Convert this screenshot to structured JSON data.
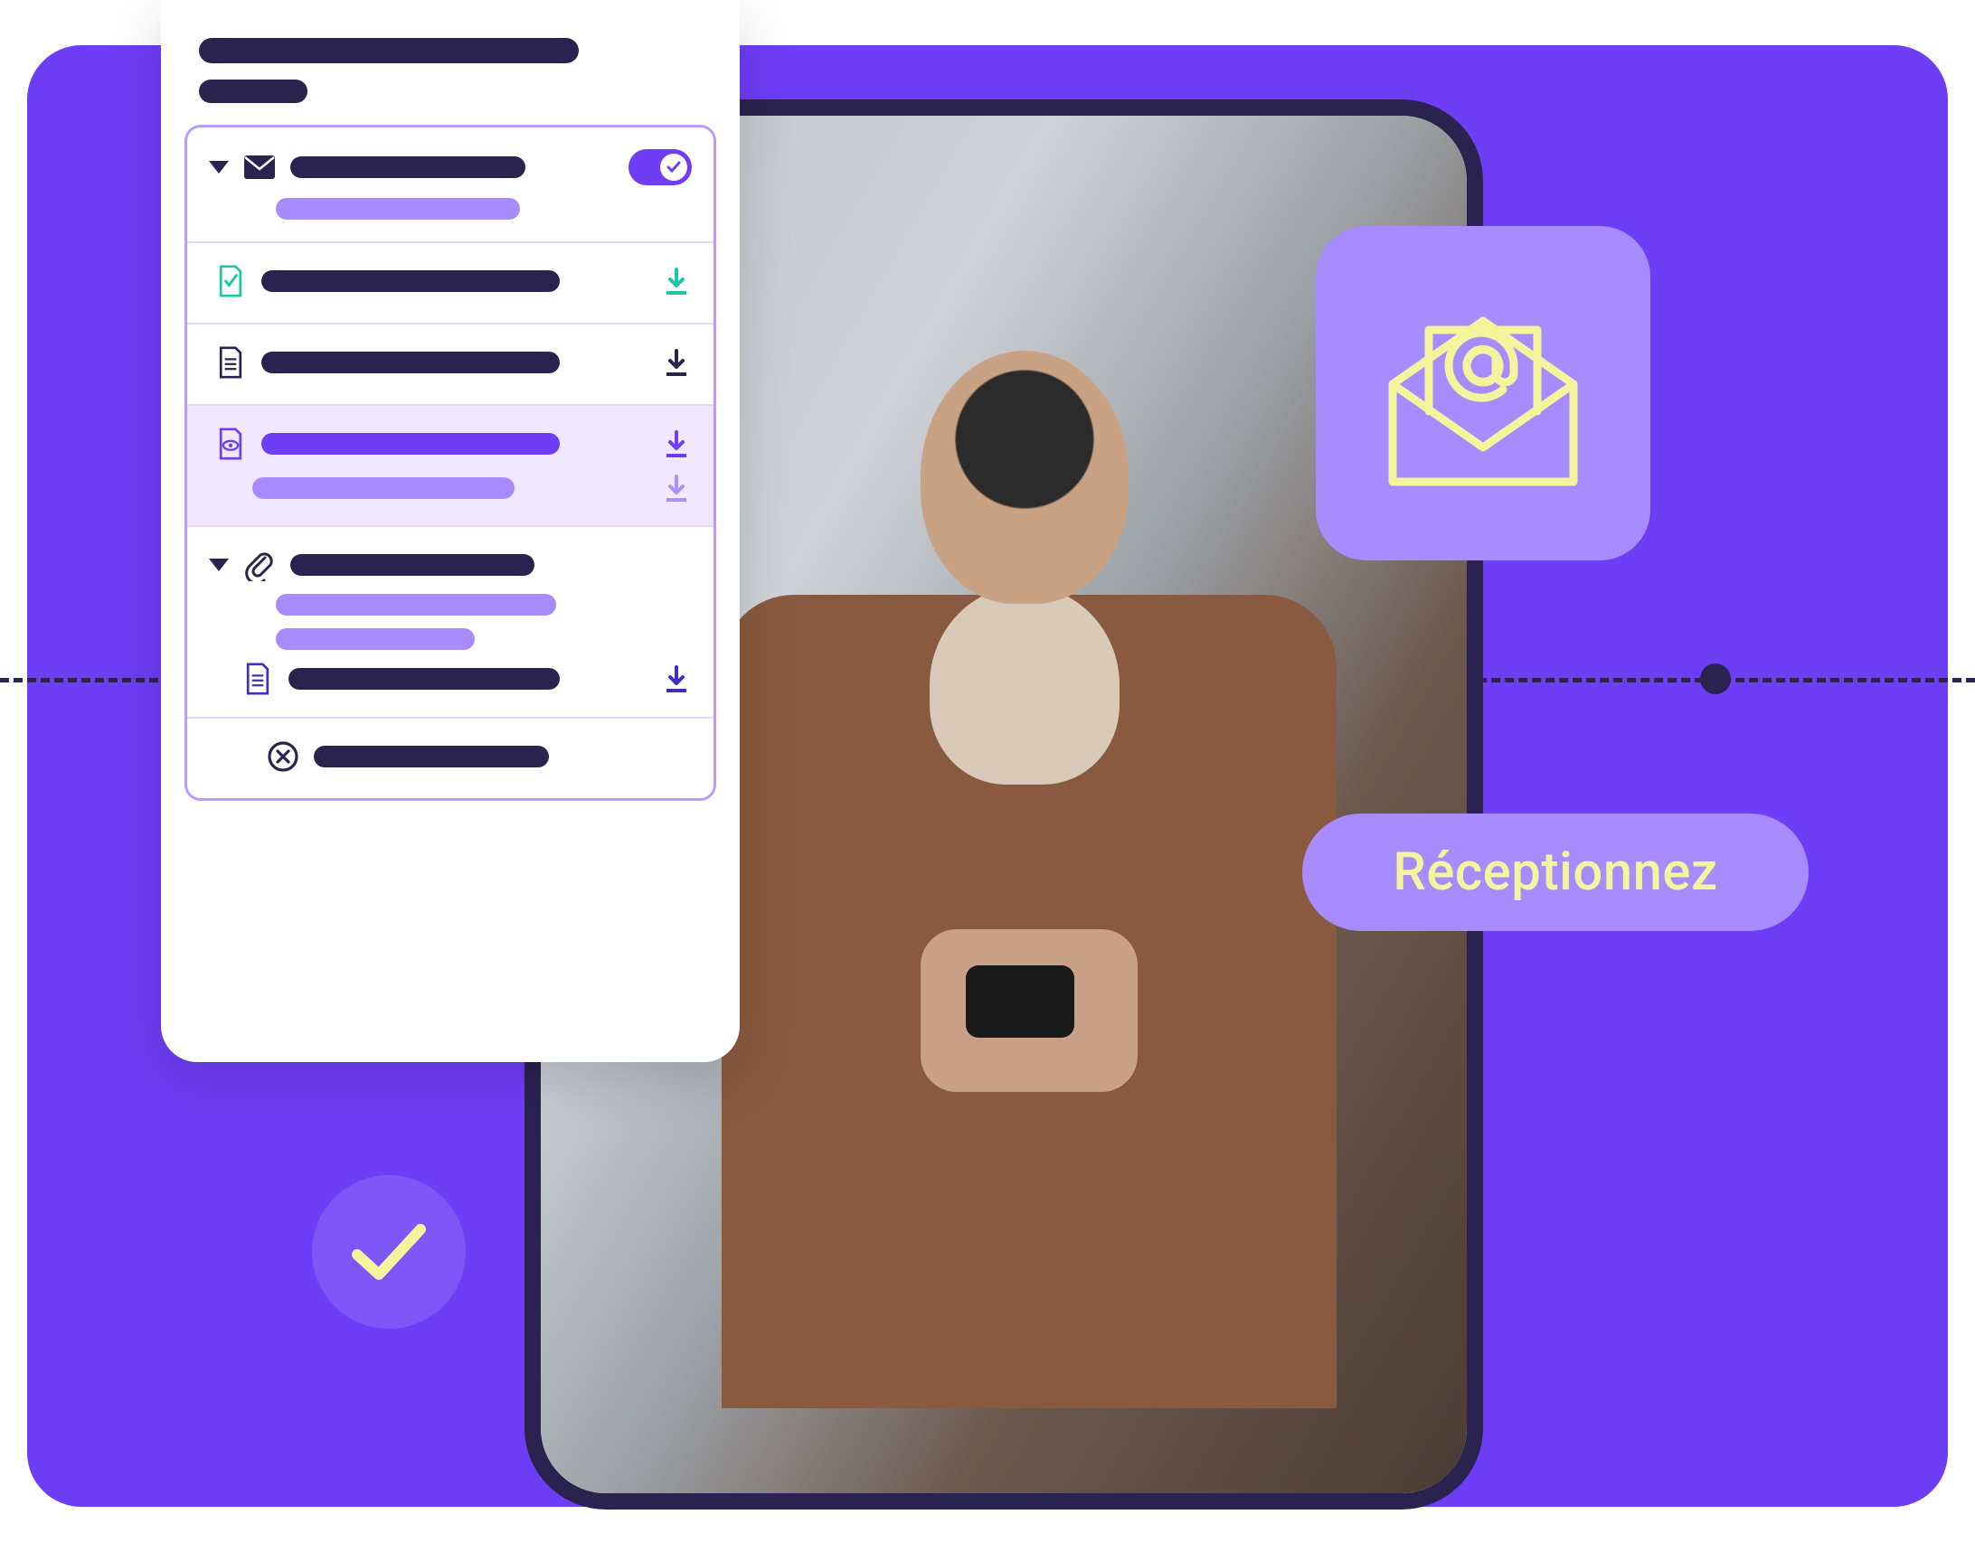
{
  "colors": {
    "bg": "#6E3DF6",
    "bg_light": "#A88CFF",
    "dark": "#2A2350",
    "accent_yellow": "#F5F39B",
    "teal": "#1FC6A6"
  },
  "label_pill": "Réceptionnez",
  "icons": {
    "envelope_at": "envelope-at-icon",
    "check": "check-icon"
  }
}
